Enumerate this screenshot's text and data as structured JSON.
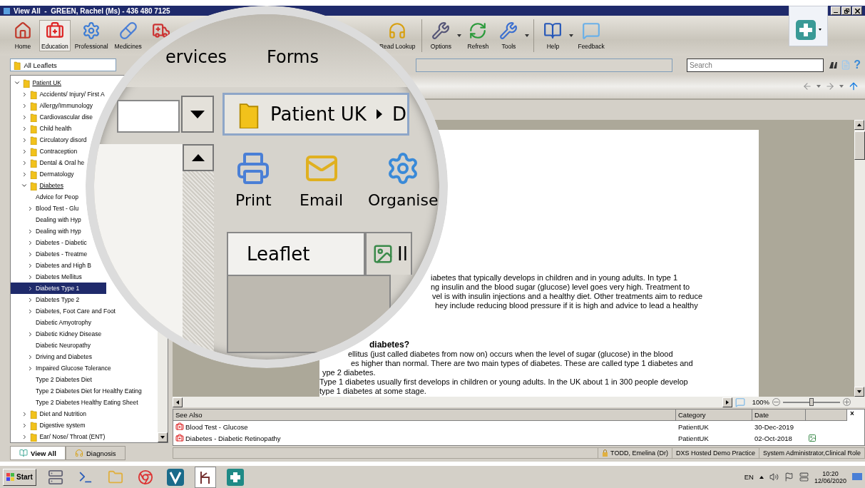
{
  "window": {
    "title": "View All  -  GREEN, Rachel (Ms) - 436 480 7125"
  },
  "toolbar": {
    "groups": [
      [
        {
          "label": "Home",
          "selected": false,
          "dropdown": false
        },
        {
          "label": "Education",
          "selected": true,
          "dropdown": false
        },
        {
          "label": "Professional",
          "selected": false,
          "dropdown": false
        },
        {
          "label": "Medicines",
          "selected": false,
          "dropdown": false
        }
      ],
      [
        {
          "label": "Read Lookup",
          "selected": false,
          "dropdown": false
        }
      ],
      [
        {
          "label": "Options",
          "selected": false,
          "dropdown": true
        },
        {
          "label": "Refresh",
          "selected": false,
          "dropdown": false
        },
        {
          "label": "Tools",
          "selected": false,
          "dropdown": true
        }
      ],
      [
        {
          "label": "Help",
          "selected": false,
          "dropdown": true
        },
        {
          "label": "Feedback",
          "selected": false,
          "dropdown": false
        }
      ]
    ]
  },
  "leaflet_filter": "All Leaflets",
  "search": {
    "placeholder": "Search"
  },
  "help_button": "?",
  "tree": [
    {
      "label": "Patient UK",
      "kind": "folder",
      "expanded": true,
      "selected": false,
      "children": [
        {
          "label": "Accidents/ Injury/ First A",
          "kind": "folder",
          "expanded": false,
          "selected": false
        },
        {
          "label": "Allergy/Immunology",
          "kind": "folder",
          "expanded": false,
          "selected": false
        },
        {
          "label": "Cardiovascular dise",
          "kind": "folder",
          "expanded": false,
          "selected": false
        },
        {
          "label": "Child health",
          "kind": "folder",
          "expanded": false,
          "selected": false
        },
        {
          "label": "Circulatory disord",
          "kind": "folder",
          "expanded": false,
          "selected": false
        },
        {
          "label": "Contraception",
          "kind": "folder",
          "expanded": false,
          "selected": false
        },
        {
          "label": "Dental & Oral he",
          "kind": "folder",
          "expanded": false,
          "selected": false
        },
        {
          "label": "Dermatology",
          "kind": "folder",
          "expanded": false,
          "selected": false
        },
        {
          "label": "Diabetes",
          "kind": "folder",
          "expanded": true,
          "selected": false,
          "children": [
            {
              "label": "Advice for Peop",
              "kind": "leaflet",
              "selected": false
            },
            {
              "label": "Blood Test - Glu",
              "kind": "topic",
              "expanded": false,
              "selected": false
            },
            {
              "label": "Dealing with Hyp",
              "kind": "leaflet",
              "selected": false
            },
            {
              "label": "Dealing with Hyp",
              "kind": "topic",
              "expanded": false,
              "selected": false
            },
            {
              "label": "Diabetes - Diabetic",
              "kind": "topic",
              "expanded": false,
              "selected": false
            },
            {
              "label": "Diabetes - Treatme",
              "kind": "topic",
              "expanded": false,
              "selected": false
            },
            {
              "label": "Diabetes and High B",
              "kind": "topic",
              "expanded": false,
              "selected": false
            },
            {
              "label": "Diabetes Mellitus",
              "kind": "topic",
              "expanded": false,
              "selected": false
            },
            {
              "label": "Diabetes Type 1",
              "kind": "topic",
              "expanded": false,
              "selected": true
            },
            {
              "label": "Diabetes Type 2",
              "kind": "topic",
              "expanded": false,
              "selected": false
            },
            {
              "label": "Diabetes, Foot Care and Foot",
              "kind": "topic",
              "expanded": false,
              "selected": false
            },
            {
              "label": "Diabetic Amyotrophy",
              "kind": "leaflet",
              "selected": false
            },
            {
              "label": "Diabetic Kidney Disease",
              "kind": "topic",
              "expanded": false,
              "selected": false
            },
            {
              "label": "Diabetic Neuropathy",
              "kind": "leaflet",
              "selected": false
            },
            {
              "label": "Driving and Diabetes",
              "kind": "topic",
              "expanded": false,
              "selected": false
            },
            {
              "label": "Impaired Glucose Tolerance",
              "kind": "topic",
              "expanded": false,
              "selected": false
            },
            {
              "label": "Type 2 Diabetes Diet",
              "kind": "leaflet",
              "selected": false
            },
            {
              "label": "Type 2 Diabetes Diet for Healthy Eating",
              "kind": "leaflet",
              "selected": false
            },
            {
              "label": "Type 2 Diabetes Healthy Eating Sheet",
              "kind": "leaflet",
              "selected": false
            }
          ]
        },
        {
          "label": "Diet and Nutrition",
          "kind": "folder",
          "expanded": false,
          "selected": false
        },
        {
          "label": "Digestive system",
          "kind": "folder",
          "expanded": false,
          "selected": false
        },
        {
          "label": "Ear/ Nose/ Throat (ENT)",
          "kind": "folder",
          "expanded": false,
          "selected": false
        }
      ]
    }
  ],
  "left_tabs": [
    {
      "label": "View All",
      "selected": true
    },
    {
      "label": "Diagnosis",
      "selected": false
    }
  ],
  "magnifier": {
    "menu": [
      "ervices",
      "Forms"
    ],
    "breadcrumb": [
      "Patient UK",
      "D"
    ],
    "actions": [
      "Print",
      "Email",
      "Organise"
    ],
    "tabs": [
      {
        "label": "Leaflet",
        "selected": true
      },
      {
        "label": "Il",
        "selected": false
      }
    ]
  },
  "document": {
    "paragraphs": [
      {
        "kind": "text",
        "lines": [
          "iabetes that typically develops in children and in young adults. In type 1",
          "ng insulin and the blood sugar (glucose) level goes very high. Treatment to",
          "vel is with insulin injections and a healthy diet. Other treatments aim to reduce",
          "hey include reducing blood pressure if it is high and advice to lead a healthy"
        ]
      },
      {
        "kind": "heading",
        "lines": [
          "diabetes?"
        ]
      },
      {
        "kind": "text",
        "lines": [
          "ellitus (just called diabetes from now on) occurs when the level of sugar (glucose) in the blood",
          "es higher than normal. There are two main types of diabetes. These are called type 1 diabetes and",
          "ype 2 diabetes."
        ]
      },
      {
        "kind": "text",
        "lines": [
          "Type 1 diabetes usually first develops in children or young adults. In the UK about 1 in 300 people develop",
          "type 1 diabetes at some stage."
        ]
      }
    ]
  },
  "zoom": {
    "reading": "100%",
    "level": 0.5
  },
  "see_also": {
    "columns": [
      "See Also",
      "Category",
      "Date"
    ],
    "close": "×",
    "rows": [
      {
        "title": "Blood Test - Glucose",
        "category": "PatientUK",
        "date": "30-Dec-2019",
        "has_image": false
      },
      {
        "title": "Diabetes - Diabetic Retinopathy",
        "category": "PatientUK",
        "date": "02-Oct-2018",
        "has_image": true
      }
    ]
  },
  "status_bar": [
    {
      "text": "TODD, Emelina (Dr)",
      "kind": "user"
    },
    {
      "text": "DXS Hosted Demo Practice",
      "kind": "plain"
    },
    {
      "text": "System Administrator,Clinical Role",
      "kind": "plain"
    }
  ],
  "taskbar": {
    "start": "Start",
    "language": "EN",
    "time": "10:20",
    "date": "12/06/2020"
  }
}
